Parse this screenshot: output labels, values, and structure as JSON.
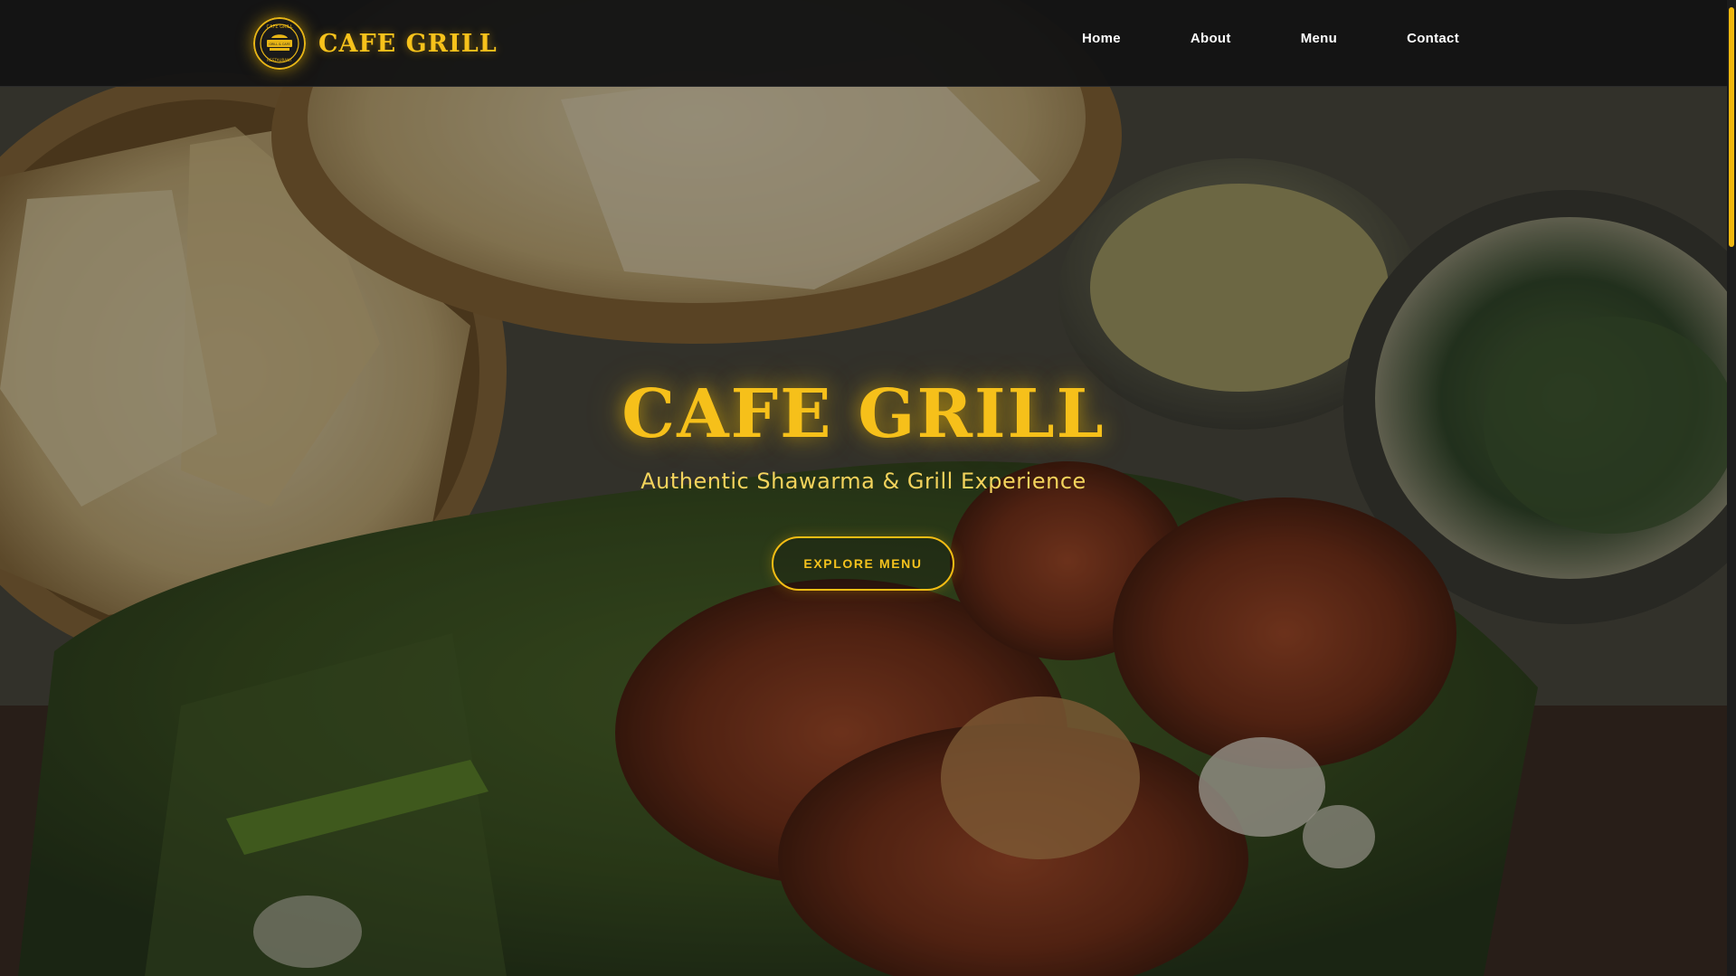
{
  "brand": {
    "name": "CAFE GRILL",
    "logo": {
      "icon": "cafe-grill-emblem-icon",
      "ring_text_top": "CAFE GRILL",
      "ring_text_bottom": "RESTAURANT",
      "banner_text": "GRILL & CAFE"
    }
  },
  "nav": {
    "items": [
      {
        "label": "Home"
      },
      {
        "label": "About"
      },
      {
        "label": "Menu"
      },
      {
        "label": "Contact"
      }
    ]
  },
  "hero": {
    "title": "CAFE GRILL",
    "subtitle": "Authentic Shawarma & Grill Experience",
    "cta_label": "EXPLORE MENU",
    "background": "food-photo-naan-curry-tandoori-chicken"
  },
  "colors": {
    "accent": "#f6c01a",
    "navbar_bg": "#141414",
    "nav_text": "#ffffff",
    "scroll_thumb": "#f0b70f"
  }
}
